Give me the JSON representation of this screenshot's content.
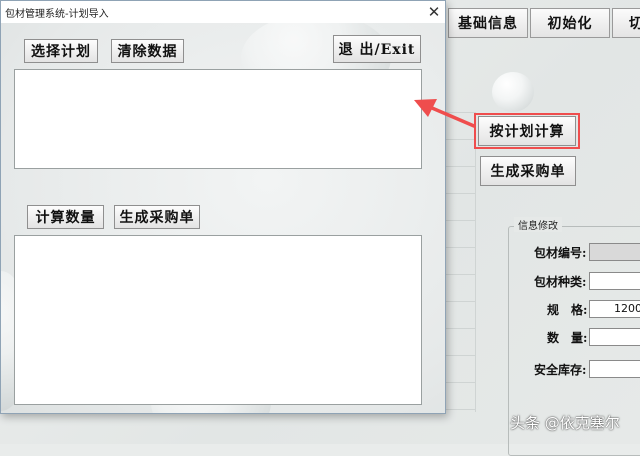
{
  "main_window": {
    "tabs": [
      "基础信息",
      "初始化",
      "切"
    ],
    "calc_by_plan_button": "按计划计算",
    "create_po_button": "生成采购单",
    "info_group": {
      "title": "信息修改",
      "fields": [
        {
          "label": "包材编号:",
          "value": ""
        },
        {
          "label": "包材种类:",
          "value": ""
        },
        {
          "label": "规　格:",
          "value": "1200"
        },
        {
          "label": "数　量:",
          "value": ""
        },
        {
          "label": "安全库存:",
          "value": ""
        }
      ]
    }
  },
  "dialog": {
    "title": "包材管理系统-计划导入",
    "close_icon": "✕",
    "select_plan_button": "选择计划",
    "clear_data_button": "清除数据",
    "exit_button": "退 出/Exit",
    "plan_textbox": "",
    "calc_qty_button": "计算数量",
    "create_po_button": "生成采购单",
    "result_textbox": ""
  },
  "annotation": {
    "color": "#ef4d4d"
  },
  "watermark": "头条 @依克塞尔"
}
